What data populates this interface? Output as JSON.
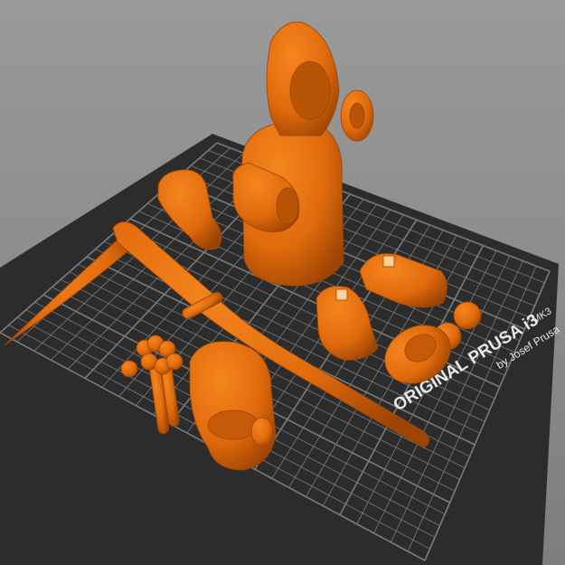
{
  "viewport": {
    "bed_label": "ORIGINAL PRUSA i3",
    "bed_model": "MK3",
    "bed_byline": "by Josef Prusa",
    "colors": {
      "background": "#8c8c8c",
      "bed": "#2c2c2c",
      "grid": "#9a9a9a",
      "model": "#e06a0c",
      "model_shadow": "#a84a05"
    }
  },
  "objects": [
    "hooded-body",
    "left-hand",
    "right-hand",
    "scythe",
    "head",
    "left-foot",
    "right-foot",
    "beads",
    "hood-face"
  ]
}
